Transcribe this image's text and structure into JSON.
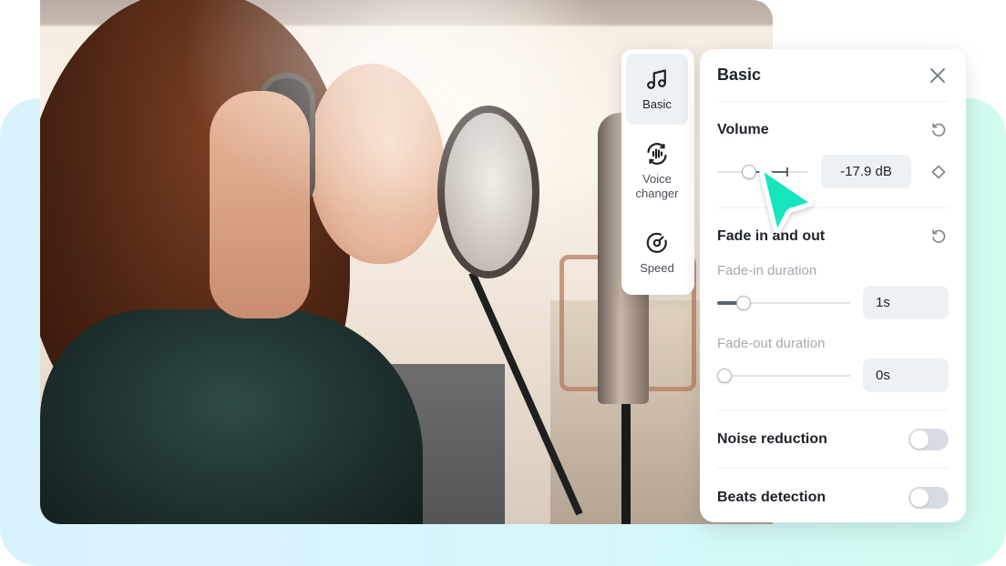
{
  "colors": {
    "accent_cursor": "#14e6bd",
    "panel_bg": "#ffffff",
    "value_box_bg": "#eef1f4",
    "toggle_off": "#d7dce2",
    "background_left": "#d9f3fd",
    "background_right": "#d0fbef"
  },
  "rail": {
    "tabs": [
      {
        "label": "Basic",
        "icon": "music-note-icon",
        "active": true
      },
      {
        "label": "Voice changer",
        "icon": "voice-changer-icon",
        "active": false
      },
      {
        "label": "Speed",
        "icon": "speedometer-icon",
        "active": false
      }
    ]
  },
  "panel": {
    "title": "Basic",
    "close_icon": "close-icon",
    "volume": {
      "label": "Volume",
      "value_text": "-17.9 dB",
      "slider_fraction": 0.35,
      "default_marker_fraction": 0.5,
      "reset_icon": "reset-icon",
      "keyframe_icon": "diamond-keyframe-icon"
    },
    "fade": {
      "label": "Fade in and out",
      "reset_icon": "reset-icon",
      "fade_in": {
        "label": "Fade-in duration",
        "value_text": "1s",
        "slider_fraction": 0.2
      },
      "fade_out": {
        "label": "Fade-out duration",
        "value_text": "0s",
        "slider_fraction": 0.0
      }
    },
    "noise_reduction": {
      "label": "Noise reduction",
      "on": false
    },
    "beats_detection": {
      "label": "Beats detection",
      "on": false
    }
  }
}
